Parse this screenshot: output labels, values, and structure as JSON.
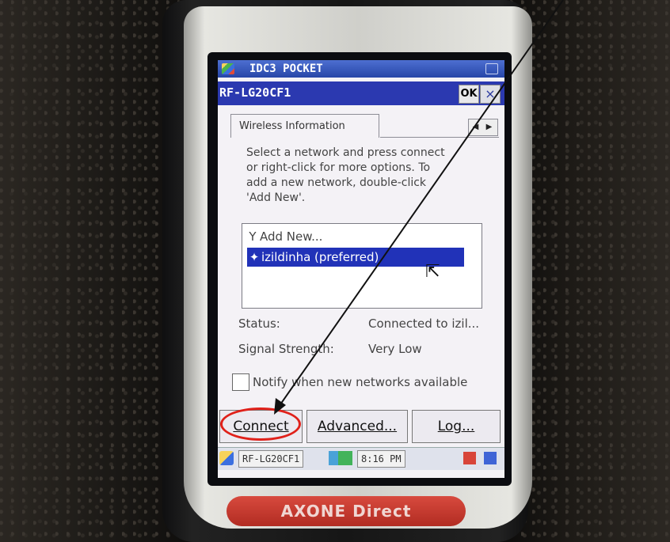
{
  "window": {
    "title": "IDC3 POCKET"
  },
  "dialog": {
    "title": "RF-LG20CF1",
    "ok_label": "OK",
    "close_label": "×"
  },
  "tab": {
    "label": "Wireless Information",
    "scroll_left": "◀",
    "scroll_right": "▶"
  },
  "instructions": [
    "Select a network and press connect",
    "or right-click for more options.  To",
    "add a new network, double-click",
    "'Add New'."
  ],
  "networks": [
    {
      "label": "Add New...",
      "icon": "antenna-icon",
      "selected": false
    },
    {
      "label": "izildinha (preferred)",
      "icon": "wireless-network-icon",
      "selected": true
    }
  ],
  "status": {
    "status_label": "Status:",
    "status_value": "Connected to izil...",
    "signal_label": "Signal Strength:",
    "signal_value": "Very Low"
  },
  "notify": {
    "label": "Notify when new networks available",
    "checked": false
  },
  "buttons": {
    "connect": "Connect",
    "advanced": "Advanced...",
    "log": "Log..."
  },
  "taskbar": {
    "item_label": "RF-LG20CF1",
    "clock": "8:16 PM"
  },
  "device": {
    "brand": "AXONE Direct"
  },
  "annotations": {
    "ellipse_color": "#e0211a",
    "arrow_color": "#111111"
  },
  "colors": {
    "title_blue": "#2b39b0",
    "selection_blue": "#2132b8",
    "logo_red": "#c8362b"
  }
}
